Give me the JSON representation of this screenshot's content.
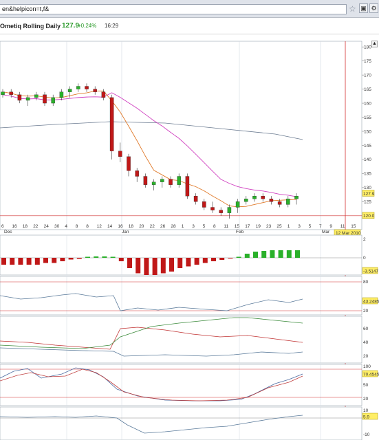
{
  "browser": {
    "url": "en&helpicon=t,f&",
    "star_icon": "star-icon"
  },
  "quote": {
    "title": "Ometiq Rolling Daily",
    "price": "127.9",
    "change": "+0.24%",
    "volume": "16:29"
  },
  "main_chart": {
    "price_labels": [
      "180",
      "175",
      "170",
      "165",
      "160",
      "155",
      "150",
      "145",
      "140",
      "135",
      "130",
      "125"
    ],
    "current_price_label": "127.9",
    "low_label": "120.0",
    "x_labels": [
      "6",
      "16",
      "18",
      "22",
      "24",
      "30",
      "4",
      "8",
      "8",
      "12",
      "14",
      "16",
      "18",
      "20",
      "22",
      "26",
      "28",
      "1",
      "3",
      "5",
      "8",
      "11",
      "15",
      "17",
      "19",
      "23",
      "25",
      "1",
      "3",
      "5",
      "7",
      "9",
      "11",
      "15"
    ],
    "month_labels": [
      "Dec",
      "Jan",
      "Feb",
      "Mar"
    ],
    "date_box": "12 Mar 2010"
  },
  "indicator1": {
    "labels": [
      "0",
      "-2"
    ],
    "value_box": "-3.5147",
    "top_label": "2"
  },
  "indicator2": {
    "labels": [
      "80",
      "60",
      "20"
    ],
    "value_box": "43.2485"
  },
  "indicator3": {
    "labels": [
      "60",
      "40",
      "20"
    ]
  },
  "indicator4": {
    "labels": [
      "100",
      "50",
      "20"
    ],
    "value_box": "70.4545"
  },
  "indicator5": {
    "labels": [
      "10",
      "-10"
    ],
    "value_box": "5.9"
  },
  "chart_data": {
    "type": "candlestick",
    "candles": [
      {
        "o": 163,
        "h": 165,
        "l": 162,
        "c": 164
      },
      {
        "o": 164,
        "h": 165,
        "l": 162,
        "c": 163
      },
      {
        "o": 163,
        "h": 164,
        "l": 160,
        "c": 161
      },
      {
        "o": 161,
        "h": 163,
        "l": 159,
        "c": 162
      },
      {
        "o": 162,
        "h": 164,
        "l": 161,
        "c": 163
      },
      {
        "o": 163,
        "h": 164,
        "l": 159,
        "c": 160
      },
      {
        "o": 160,
        "h": 163,
        "l": 159,
        "c": 162
      },
      {
        "o": 162,
        "h": 165,
        "l": 161,
        "c": 164
      },
      {
        "o": 164,
        "h": 166,
        "l": 162,
        "c": 165
      },
      {
        "o": 165,
        "h": 167,
        "l": 164,
        "c": 166
      },
      {
        "o": 166,
        "h": 167,
        "l": 164,
        "c": 165
      },
      {
        "o": 165,
        "h": 166,
        "l": 163,
        "c": 164
      },
      {
        "o": 164,
        "h": 165,
        "l": 161,
        "c": 162
      },
      {
        "o": 162,
        "h": 163,
        "l": 140,
        "c": 143
      },
      {
        "o": 143,
        "h": 146,
        "l": 139,
        "c": 141
      },
      {
        "o": 141,
        "h": 142,
        "l": 134,
        "c": 136
      },
      {
        "o": 136,
        "h": 137,
        "l": 132,
        "c": 134
      },
      {
        "o": 134,
        "h": 135,
        "l": 130,
        "c": 131
      },
      {
        "o": 131,
        "h": 133,
        "l": 129,
        "c": 132
      },
      {
        "o": 132,
        "h": 134,
        "l": 130,
        "c": 133
      },
      {
        "o": 133,
        "h": 134,
        "l": 130,
        "c": 131
      },
      {
        "o": 131,
        "h": 135,
        "l": 130,
        "c": 134
      },
      {
        "o": 134,
        "h": 135,
        "l": 126,
        "c": 127
      },
      {
        "o": 127,
        "h": 128,
        "l": 124,
        "c": 125
      },
      {
        "o": 125,
        "h": 126,
        "l": 122,
        "c": 123
      },
      {
        "o": 123,
        "h": 125,
        "l": 121,
        "c": 122
      },
      {
        "o": 122,
        "h": 123,
        "l": 120,
        "c": 121
      },
      {
        "o": 121,
        "h": 124,
        "l": 119,
        "c": 123
      },
      {
        "o": 123,
        "h": 126,
        "l": 121,
        "c": 125
      },
      {
        "o": 125,
        "h": 127,
        "l": 124,
        "c": 126
      },
      {
        "o": 126,
        "h": 128,
        "l": 125,
        "c": 127
      },
      {
        "o": 127,
        "h": 128,
        "l": 125,
        "c": 126
      },
      {
        "o": 126,
        "h": 127,
        "l": 124,
        "c": 125
      },
      {
        "o": 125,
        "h": 126,
        "l": 123,
        "c": 124
      },
      {
        "o": 124,
        "h": 127,
        "l": 123,
        "c": 126
      },
      {
        "o": 126,
        "h": 128,
        "l": 124,
        "c": 127
      }
    ]
  },
  "colors": {
    "up": "#2ab02a",
    "down": "#c01818",
    "ma_short": "#e07a2a",
    "ma_mid": "#d040c0",
    "ma_long": "#6a7a90",
    "grid": "#d0d8e0",
    "accent_box": "#ffee66"
  }
}
